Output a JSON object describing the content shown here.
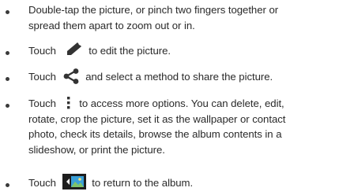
{
  "bullets": [
    {
      "line1": "Double-tap the picture, or pinch two fingers together or",
      "line2": "spread them apart to zoom out or in."
    },
    {
      "before": "Touch",
      "icon": "pencil-icon",
      "after": "to edit the picture."
    },
    {
      "before": "Touch",
      "icon": "share-icon",
      "after": "and select a method to share the picture."
    },
    {
      "before": "Touch",
      "icon": "more-options-icon",
      "after": "to access more options. You can delete, edit,",
      "line2": "rotate, crop the picture, set it as the wallpaper or contact",
      "line3": "photo, check its details, browse the album contents in a",
      "line4": "slideshow, or print the picture."
    },
    {
      "before": "Touch",
      "icon": "album-back-icon",
      "after": "to return to the album."
    }
  ],
  "colors": {
    "text": "#2a2a2a",
    "album_icon_green": "#7fc46a",
    "album_icon_blue": "#3aa0d8"
  }
}
